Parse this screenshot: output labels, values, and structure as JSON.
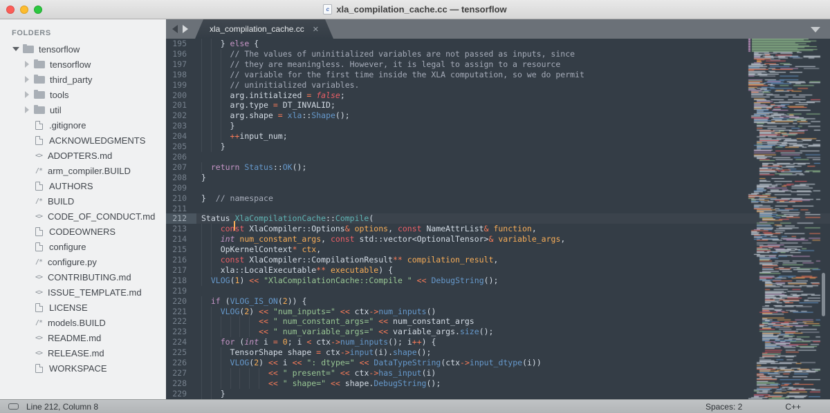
{
  "window": {
    "title": "xla_compilation_cache.cc — tensorflow",
    "doc_icon_glyph": "c"
  },
  "colors": {
    "editor_bg": "#343d46",
    "tabbar_bg": "#6b7178",
    "sidebar_bg": "#f0f1f2",
    "cursor": "#f9ae58",
    "scheme": {
      "pl": "#d5dde6",
      "kw": "#c695c6",
      "st": "#c695c6",
      "cs": "#ec5f66",
      "bo": "#ec5f66",
      "op": "#f97b58",
      "nu": "#f9ae58",
      "pa": "#f9ae58",
      "fn": "#6699cc",
      "en": "#5fb4b4",
      "str": "#99c794",
      "cm": "#a6acb9"
    }
  },
  "sidebar": {
    "header": "FOLDERS",
    "items": [
      {
        "kind": "folder-open",
        "label": "tensorflow",
        "depth": 0
      },
      {
        "kind": "folder",
        "label": "tensorflow",
        "depth": 1
      },
      {
        "kind": "folder",
        "label": "third_party",
        "depth": 1
      },
      {
        "kind": "folder",
        "label": "tools",
        "depth": 1
      },
      {
        "kind": "folder",
        "label": "util",
        "depth": 1
      },
      {
        "kind": "file",
        "label": ".gitignore",
        "depth": 1
      },
      {
        "kind": "file",
        "label": "ACKNOWLEDGMENTS",
        "depth": 1
      },
      {
        "kind": "file-md",
        "label": "ADOPTERS.md",
        "depth": 1
      },
      {
        "kind": "file-build",
        "label": "arm_compiler.BUILD",
        "depth": 1
      },
      {
        "kind": "file",
        "label": "AUTHORS",
        "depth": 1
      },
      {
        "kind": "file-build",
        "label": "BUILD",
        "depth": 1
      },
      {
        "kind": "file-md",
        "label": "CODE_OF_CONDUCT.md",
        "depth": 1
      },
      {
        "kind": "file",
        "label": "CODEOWNERS",
        "depth": 1
      },
      {
        "kind": "file",
        "label": "configure",
        "depth": 1
      },
      {
        "kind": "file-build",
        "label": "configure.py",
        "depth": 1
      },
      {
        "kind": "file-md",
        "label": "CONTRIBUTING.md",
        "depth": 1
      },
      {
        "kind": "file-md",
        "label": "ISSUE_TEMPLATE.md",
        "depth": 1
      },
      {
        "kind": "file",
        "label": "LICENSE",
        "depth": 1
      },
      {
        "kind": "file-build",
        "label": "models.BUILD",
        "depth": 1
      },
      {
        "kind": "file-md",
        "label": "README.md",
        "depth": 1
      },
      {
        "kind": "file-md",
        "label": "RELEASE.md",
        "depth": 1
      },
      {
        "kind": "file",
        "label": "WORKSPACE",
        "depth": 1
      }
    ],
    "icon_md": "<>",
    "icon_build": "/*"
  },
  "tabbar": {
    "active_tab": {
      "label": "xla_compilation_cache.cc",
      "close_glyph": "✕"
    }
  },
  "editor": {
    "current_line": 212,
    "lines": [
      {
        "n": 195,
        "t": [
          [
            "pl",
            "    } "
          ],
          [
            "kw",
            "else"
          ],
          [
            "pl",
            " {"
          ]
        ]
      },
      {
        "n": 196,
        "t": [
          [
            "pl",
            "      "
          ],
          [
            "cm",
            "// The values of uninitialized variables are not passed as inputs, since"
          ]
        ]
      },
      {
        "n": 197,
        "t": [
          [
            "pl",
            "      "
          ],
          [
            "cm",
            "// they are meaningless. However, it is legal to assign to a resource"
          ]
        ]
      },
      {
        "n": 198,
        "t": [
          [
            "pl",
            "      "
          ],
          [
            "cm",
            "// variable for the first time inside the XLA computation, so we do permit"
          ]
        ]
      },
      {
        "n": 199,
        "t": [
          [
            "pl",
            "      "
          ],
          [
            "cm",
            "// uninitialized variables."
          ]
        ]
      },
      {
        "n": 200,
        "t": [
          [
            "pl",
            "      arg.initialized "
          ],
          [
            "op",
            "="
          ],
          [
            "pl",
            " "
          ],
          [
            "bo",
            "false"
          ],
          [
            "pl",
            ";"
          ]
        ]
      },
      {
        "n": 201,
        "t": [
          [
            "pl",
            "      arg.type "
          ],
          [
            "op",
            "="
          ],
          [
            "pl",
            " DT_INVALID;"
          ]
        ]
      },
      {
        "n": 202,
        "t": [
          [
            "pl",
            "      arg.shape "
          ],
          [
            "op",
            "="
          ],
          [
            "pl",
            " "
          ],
          [
            "fn",
            "xla"
          ],
          [
            "pl",
            "::"
          ],
          [
            "fn",
            "Shape"
          ],
          [
            "pl",
            "();"
          ]
        ]
      },
      {
        "n": 203,
        "t": [
          [
            "pl",
            "      }"
          ]
        ]
      },
      {
        "n": 204,
        "t": [
          [
            "pl",
            "      "
          ],
          [
            "op",
            "++"
          ],
          [
            "pl",
            "input_num;"
          ]
        ]
      },
      {
        "n": 205,
        "t": [
          [
            "pl",
            "    }"
          ]
        ]
      },
      {
        "n": 206,
        "t": []
      },
      {
        "n": 207,
        "t": [
          [
            "pl",
            "  "
          ],
          [
            "kw",
            "return"
          ],
          [
            "pl",
            " "
          ],
          [
            "fn",
            "Status"
          ],
          [
            "pl",
            "::"
          ],
          [
            "fn",
            "OK"
          ],
          [
            "pl",
            "();"
          ]
        ]
      },
      {
        "n": 208,
        "t": [
          [
            "pl",
            "}"
          ]
        ]
      },
      {
        "n": 209,
        "t": []
      },
      {
        "n": 210,
        "t": [
          [
            "pl",
            "}  "
          ],
          [
            "cm",
            "// namespace"
          ]
        ]
      },
      {
        "n": 211,
        "t": []
      },
      {
        "n": 212,
        "t": [
          [
            "pl",
            "Status "
          ],
          [
            "caret",
            ""
          ],
          [
            "en",
            "XlaCompilationCache"
          ],
          [
            "pl",
            "::"
          ],
          [
            "en",
            "Compile"
          ],
          [
            "pl",
            "("
          ]
        ]
      },
      {
        "n": 213,
        "t": [
          [
            "pl",
            "    "
          ],
          [
            "cs",
            "const"
          ],
          [
            "pl",
            " XlaCompiler::Options"
          ],
          [
            "op",
            "&"
          ],
          [
            "pl",
            " "
          ],
          [
            "pa",
            "options"
          ],
          [
            "pl",
            ", "
          ],
          [
            "cs",
            "const"
          ],
          [
            "pl",
            " NameAttrList"
          ],
          [
            "op",
            "&"
          ],
          [
            "pl",
            " "
          ],
          [
            "pa",
            "function"
          ],
          [
            "pl",
            ","
          ]
        ]
      },
      {
        "n": 214,
        "t": [
          [
            "pl",
            "    "
          ],
          [
            "st",
            "int"
          ],
          [
            "pl",
            " "
          ],
          [
            "pa",
            "num_constant_args"
          ],
          [
            "pl",
            ", "
          ],
          [
            "cs",
            "const"
          ],
          [
            "pl",
            " std::vector<OptionalTensor>"
          ],
          [
            "op",
            "&"
          ],
          [
            "pl",
            " "
          ],
          [
            "pa",
            "variable_args"
          ],
          [
            "pl",
            ","
          ]
        ]
      },
      {
        "n": 215,
        "t": [
          [
            "pl",
            "    OpKernelContext"
          ],
          [
            "op",
            "*"
          ],
          [
            "pl",
            " "
          ],
          [
            "pa",
            "ctx"
          ],
          [
            "pl",
            ","
          ]
        ]
      },
      {
        "n": 216,
        "t": [
          [
            "pl",
            "    "
          ],
          [
            "cs",
            "const"
          ],
          [
            "pl",
            " XlaCompiler::CompilationResult"
          ],
          [
            "op",
            "**"
          ],
          [
            "pl",
            " "
          ],
          [
            "pa",
            "compilation_result"
          ],
          [
            "pl",
            ","
          ]
        ]
      },
      {
        "n": 217,
        "t": [
          [
            "pl",
            "    xla::LocalExecutable"
          ],
          [
            "op",
            "**"
          ],
          [
            "pl",
            " "
          ],
          [
            "pa",
            "executable"
          ],
          [
            "pl",
            ") {"
          ]
        ]
      },
      {
        "n": 218,
        "t": [
          [
            "pl",
            "  "
          ],
          [
            "fn",
            "VLOG"
          ],
          [
            "pl",
            "("
          ],
          [
            "nu",
            "1"
          ],
          [
            "pl",
            ") "
          ],
          [
            "op",
            "<<"
          ],
          [
            "pl",
            " "
          ],
          [
            "str",
            "\"XlaCompilationCache::Compile \""
          ],
          [
            "pl",
            " "
          ],
          [
            "op",
            "<<"
          ],
          [
            "pl",
            " "
          ],
          [
            "fn",
            "DebugString"
          ],
          [
            "pl",
            "();"
          ]
        ]
      },
      {
        "n": 219,
        "t": []
      },
      {
        "n": 220,
        "t": [
          [
            "pl",
            "  "
          ],
          [
            "kw",
            "if"
          ],
          [
            "pl",
            " ("
          ],
          [
            "fn",
            "VLOG_IS_ON"
          ],
          [
            "pl",
            "("
          ],
          [
            "nu",
            "2"
          ],
          [
            "pl",
            ")) {"
          ]
        ]
      },
      {
        "n": 221,
        "t": [
          [
            "pl",
            "    "
          ],
          [
            "fn",
            "VLOG"
          ],
          [
            "pl",
            "("
          ],
          [
            "nu",
            "2"
          ],
          [
            "pl",
            ") "
          ],
          [
            "op",
            "<<"
          ],
          [
            "pl",
            " "
          ],
          [
            "str",
            "\"num_inputs=\""
          ],
          [
            "pl",
            " "
          ],
          [
            "op",
            "<<"
          ],
          [
            "pl",
            " ctx"
          ],
          [
            "op",
            "->"
          ],
          [
            "fn",
            "num_inputs"
          ],
          [
            "pl",
            "()"
          ]
        ]
      },
      {
        "n": 222,
        "t": [
          [
            "pl",
            "            "
          ],
          [
            "op",
            "<<"
          ],
          [
            "pl",
            " "
          ],
          [
            "str",
            "\" num_constant_args=\""
          ],
          [
            "pl",
            " "
          ],
          [
            "op",
            "<<"
          ],
          [
            "pl",
            " num_constant_args"
          ]
        ]
      },
      {
        "n": 223,
        "t": [
          [
            "pl",
            "            "
          ],
          [
            "op",
            "<<"
          ],
          [
            "pl",
            " "
          ],
          [
            "str",
            "\" num_variable_args=\""
          ],
          [
            "pl",
            " "
          ],
          [
            "op",
            "<<"
          ],
          [
            "pl",
            " variable_args."
          ],
          [
            "fn",
            "size"
          ],
          [
            "pl",
            "();"
          ]
        ]
      },
      {
        "n": 224,
        "t": [
          [
            "pl",
            "    "
          ],
          [
            "kw",
            "for"
          ],
          [
            "pl",
            " ("
          ],
          [
            "st",
            "int"
          ],
          [
            "pl",
            " i "
          ],
          [
            "op",
            "="
          ],
          [
            "pl",
            " "
          ],
          [
            "nu",
            "0"
          ],
          [
            "pl",
            "; i "
          ],
          [
            "op",
            "<"
          ],
          [
            "pl",
            " ctx"
          ],
          [
            "op",
            "->"
          ],
          [
            "fn",
            "num_inputs"
          ],
          [
            "pl",
            "(); i"
          ],
          [
            "op",
            "++"
          ],
          [
            "pl",
            ") {"
          ]
        ]
      },
      {
        "n": 225,
        "t": [
          [
            "pl",
            "      TensorShape shape "
          ],
          [
            "op",
            "="
          ],
          [
            "pl",
            " ctx"
          ],
          [
            "op",
            "->"
          ],
          [
            "fn",
            "input"
          ],
          [
            "pl",
            "(i)."
          ],
          [
            "fn",
            "shape"
          ],
          [
            "pl",
            "();"
          ]
        ]
      },
      {
        "n": 226,
        "t": [
          [
            "pl",
            "      "
          ],
          [
            "fn",
            "VLOG"
          ],
          [
            "pl",
            "("
          ],
          [
            "nu",
            "2"
          ],
          [
            "pl",
            ") "
          ],
          [
            "op",
            "<<"
          ],
          [
            "pl",
            " i "
          ],
          [
            "op",
            "<<"
          ],
          [
            "pl",
            " "
          ],
          [
            "str",
            "\": dtype=\""
          ],
          [
            "pl",
            " "
          ],
          [
            "op",
            "<<"
          ],
          [
            "pl",
            " "
          ],
          [
            "fn",
            "DataTypeString"
          ],
          [
            "pl",
            "(ctx"
          ],
          [
            "op",
            "->"
          ],
          [
            "fn",
            "input_dtype"
          ],
          [
            "pl",
            "(i))"
          ]
        ]
      },
      {
        "n": 227,
        "t": [
          [
            "pl",
            "              "
          ],
          [
            "op",
            "<<"
          ],
          [
            "pl",
            " "
          ],
          [
            "str",
            "\" present=\""
          ],
          [
            "pl",
            " "
          ],
          [
            "op",
            "<<"
          ],
          [
            "pl",
            " ctx"
          ],
          [
            "op",
            "->"
          ],
          [
            "fn",
            "has_input"
          ],
          [
            "pl",
            "(i)"
          ]
        ]
      },
      {
        "n": 228,
        "t": [
          [
            "pl",
            "              "
          ],
          [
            "op",
            "<<"
          ],
          [
            "pl",
            " "
          ],
          [
            "str",
            "\" shape=\""
          ],
          [
            "pl",
            " "
          ],
          [
            "op",
            "<<"
          ],
          [
            "pl",
            " shape."
          ],
          [
            "fn",
            "DebugString"
          ],
          [
            "pl",
            "();"
          ]
        ]
      },
      {
        "n": 229,
        "t": [
          [
            "pl",
            "    }"
          ]
        ]
      }
    ]
  },
  "statusbar": {
    "position": "Line 212, Column 8",
    "spaces": "Spaces: 2",
    "syntax": "C++"
  }
}
